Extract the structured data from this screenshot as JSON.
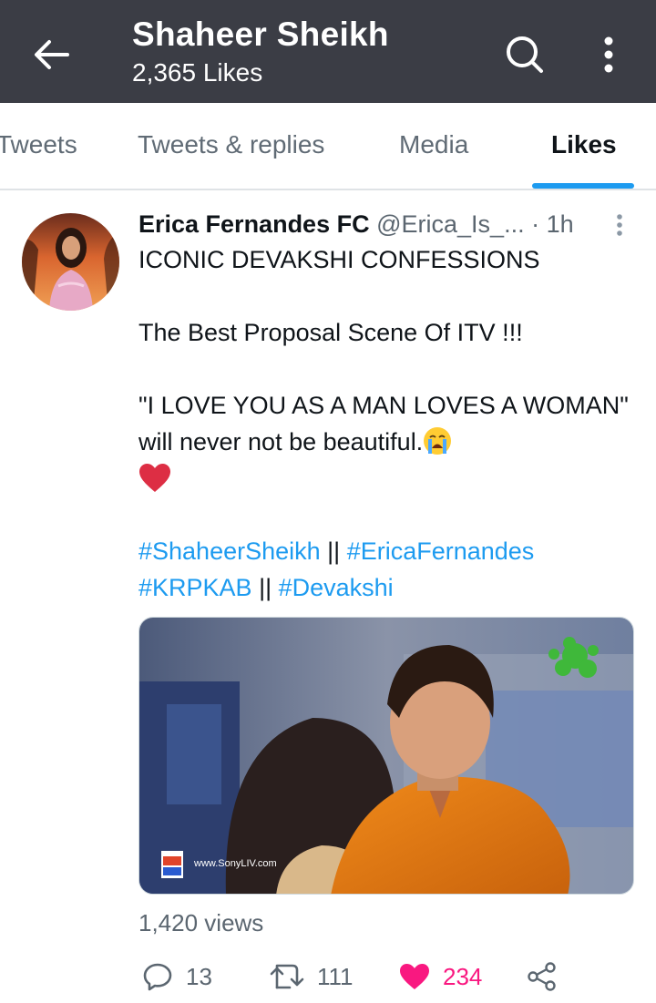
{
  "header": {
    "title": "Shaheer Sheikh",
    "subtitle": "2,365 Likes",
    "background": "#3b3d45"
  },
  "tabs": [
    {
      "label": "Tweets",
      "active": false
    },
    {
      "label": "Tweets & replies",
      "active": false
    },
    {
      "label": "Media",
      "active": false
    },
    {
      "label": "Likes",
      "active": true
    }
  ],
  "tweet": {
    "author_name": "Erica Fernandes FC",
    "handle": "@Erica_Is_...",
    "separator": "·",
    "time": "1h",
    "line1": "ICONIC DEVAKSHI CONFESSIONS",
    "line2": "The Best Proposal Scene Of ITV !!!",
    "line3": "\"I LOVE YOU AS A MAN LOVES A WOMAN\" will never not be beautiful.",
    "hashtag1": "#ShaheerSheikh",
    "sep1": " || ",
    "hashtag2": "#EricaFernandes",
    "hashtag3": "#KRPKAB",
    "sep2": " || ",
    "hashtag4": "#Devakshi",
    "media_watermark": "www.SonyLIV.com",
    "views": "1,420 views"
  },
  "actions": {
    "replies": "13",
    "retweets": "111",
    "likes": "234"
  },
  "icons": [
    "arrow-left-icon",
    "search-icon",
    "more-vertical-icon",
    "caret-icon",
    "crying-face-icon",
    "heart-emoji-icon",
    "reply-icon",
    "retweet-icon",
    "heart-icon",
    "share-icon"
  ],
  "colors": {
    "accent": "#1d9bf0",
    "like": "#f91880",
    "muted": "#5b6670"
  }
}
